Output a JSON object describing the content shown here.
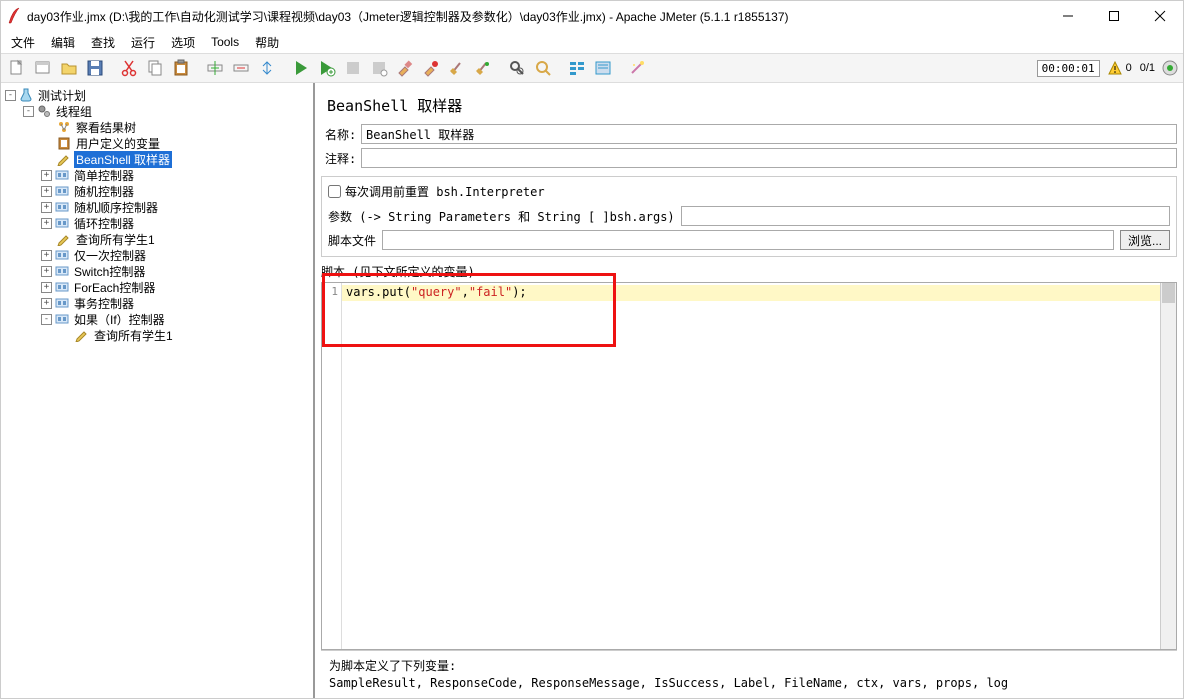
{
  "window": {
    "title": "day03作业.jmx (D:\\我的工作\\自动化测试学习\\课程视频\\day03（Jmeter逻辑控制器及参数化）\\day03作业.jmx) - Apache JMeter (5.1.1 r1855137)"
  },
  "menu": {
    "file": "文件",
    "edit": "编辑",
    "search": "查找",
    "run": "运行",
    "options": "选项",
    "tools": "Tools",
    "help": "帮助"
  },
  "status": {
    "timer": "00:00:01",
    "warn_count": "0",
    "thread_count": "0/1"
  },
  "tree": {
    "items": [
      {
        "indent": 0,
        "toggle": "-",
        "icon": "flask",
        "label": "测试计划",
        "selected": false
      },
      {
        "indent": 1,
        "toggle": "-",
        "icon": "gears",
        "label": "线程组",
        "selected": false
      },
      {
        "indent": 2,
        "toggle": "",
        "icon": "tree",
        "label": "察看结果树",
        "selected": false
      },
      {
        "indent": 2,
        "toggle": "",
        "icon": "clip",
        "label": "用户定义的变量",
        "selected": false
      },
      {
        "indent": 2,
        "toggle": "",
        "icon": "pencil",
        "label": "BeanShell 取样器",
        "selected": true
      },
      {
        "indent": 2,
        "toggle": "+",
        "icon": "ctrl",
        "label": "简单控制器",
        "selected": false
      },
      {
        "indent": 2,
        "toggle": "+",
        "icon": "ctrl",
        "label": "随机控制器",
        "selected": false
      },
      {
        "indent": 2,
        "toggle": "+",
        "icon": "ctrl",
        "label": "随机顺序控制器",
        "selected": false
      },
      {
        "indent": 2,
        "toggle": "+",
        "icon": "ctrl",
        "label": "循环控制器",
        "selected": false
      },
      {
        "indent": 2,
        "toggle": "",
        "icon": "pencil",
        "label": "查询所有学生1",
        "selected": false
      },
      {
        "indent": 2,
        "toggle": "+",
        "icon": "ctrl",
        "label": "仅一次控制器",
        "selected": false
      },
      {
        "indent": 2,
        "toggle": "+",
        "icon": "ctrl",
        "label": "Switch控制器",
        "selected": false
      },
      {
        "indent": 2,
        "toggle": "+",
        "icon": "ctrl",
        "label": "ForEach控制器",
        "selected": false
      },
      {
        "indent": 2,
        "toggle": "+",
        "icon": "ctrl",
        "label": "事务控制器",
        "selected": false
      },
      {
        "indent": 2,
        "toggle": "-",
        "icon": "ctrl",
        "label": "如果（If）控制器",
        "selected": false
      },
      {
        "indent": 3,
        "toggle": "",
        "icon": "pencil",
        "label": "查询所有学生1",
        "selected": false
      }
    ]
  },
  "panel": {
    "title": "BeanShell 取样器",
    "name_label": "名称:",
    "name_value": "BeanShell 取样器",
    "comment_label": "注释:",
    "comment_value": "",
    "reset_label": "每次调用前重置 bsh.Interpreter",
    "params_label": "参数 (-> String Parameters 和 String [ ]bsh.args)",
    "params_value": "",
    "file_label": "脚本文件",
    "file_value": "",
    "browse_label": "浏览...",
    "script_label": "脚本 (见下文所定义的变量)",
    "code_line": "1",
    "code_prefix": "vars.put(",
    "code_str1": "\"query\"",
    "code_comma": ",",
    "code_str2": "\"fail\"",
    "code_suffix": ");"
  },
  "footer": {
    "line1": "为脚本定义了下列变量:",
    "line2": "SampleResult, ResponseCode, ResponseMessage, IsSuccess, Label, FileName, ctx, vars, props, log"
  }
}
